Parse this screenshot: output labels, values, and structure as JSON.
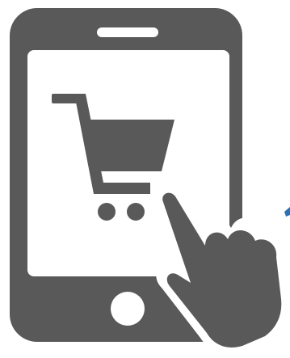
{
  "illustration": {
    "subject": "tablet-shopping-cart-with-pointing-hand",
    "icons": [
      "tablet-icon",
      "shopping-cart-icon",
      "pointing-hand-icon"
    ],
    "colors": {
      "device": "#595959",
      "screen": "#ffffff",
      "accent": "#2e6fb5"
    }
  }
}
